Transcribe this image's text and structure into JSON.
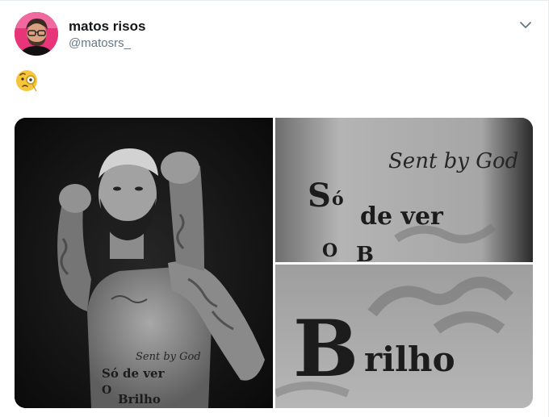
{
  "author": {
    "display_name": "matos risos",
    "handle": "@matosrs_"
  },
  "tweet": {
    "text_emoji": "🧐",
    "emoji_icon": "face-with-monocle-icon"
  },
  "menu": {
    "icon": "chevron-down-icon"
  },
  "media": {
    "photo_count": 3,
    "tattoo_text": {
      "script_line": "Sent by God",
      "line_1": "Só de ver",
      "line_2": "O",
      "line_3": "Brilho"
    }
  },
  "colors": {
    "name_text": "#14171a",
    "secondary_text": "#657786",
    "border": "#e6ecf0",
    "avatar_bg": "#e8357a"
  }
}
